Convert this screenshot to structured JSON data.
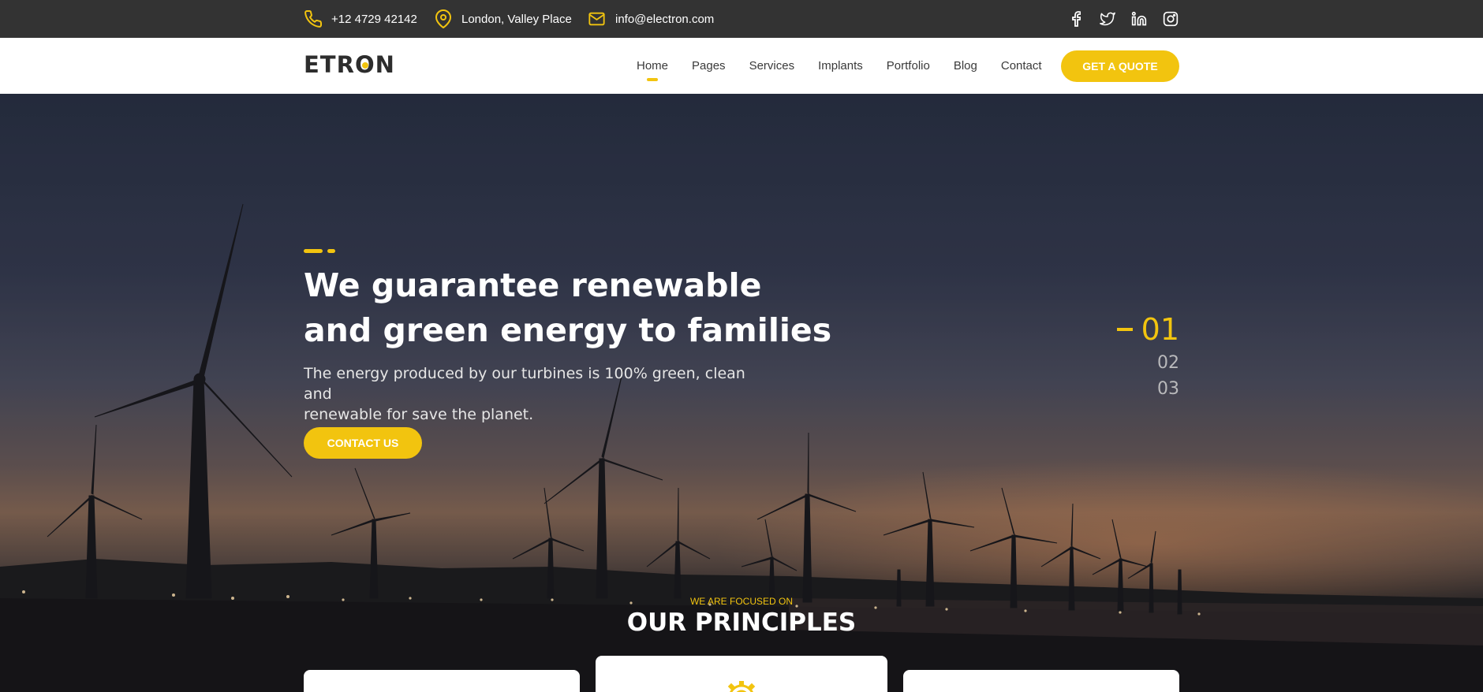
{
  "topbar": {
    "phone": "+12 4729 42142",
    "location": "London, Valley Place",
    "email": "info@electron.com",
    "social_icons": [
      "facebook-icon",
      "twitter-icon",
      "linkedin-icon",
      "instagram-icon"
    ]
  },
  "header": {
    "logo": {
      "prefix": "ETR",
      "o": "O",
      "suffix": "N"
    },
    "nav": [
      "Home",
      "Pages",
      "Services",
      "Implants",
      "Portfolio",
      "Blog",
      "Contact"
    ],
    "active_nav": "Home",
    "cta_label": "GET A QUOTE"
  },
  "hero": {
    "headline_line1": "We guarantee renewable",
    "headline_line2": "and green energy to families",
    "subtext_line1": "The energy produced by our turbines is 100% green, clean and",
    "subtext_line2": "renewable for save the planet.",
    "contact_label": "CONTACT US",
    "slides": [
      "01",
      "02",
      "03"
    ],
    "active_slide": "01"
  },
  "principles": {
    "kicker": "WE ARE FOCUSED ON",
    "title": "OUR PRINCIPLES",
    "card_icon": "gear-icon"
  },
  "colors": {
    "accent": "#f2c40f",
    "topbar_bg": "#333333",
    "header_bg": "#ffffff"
  }
}
